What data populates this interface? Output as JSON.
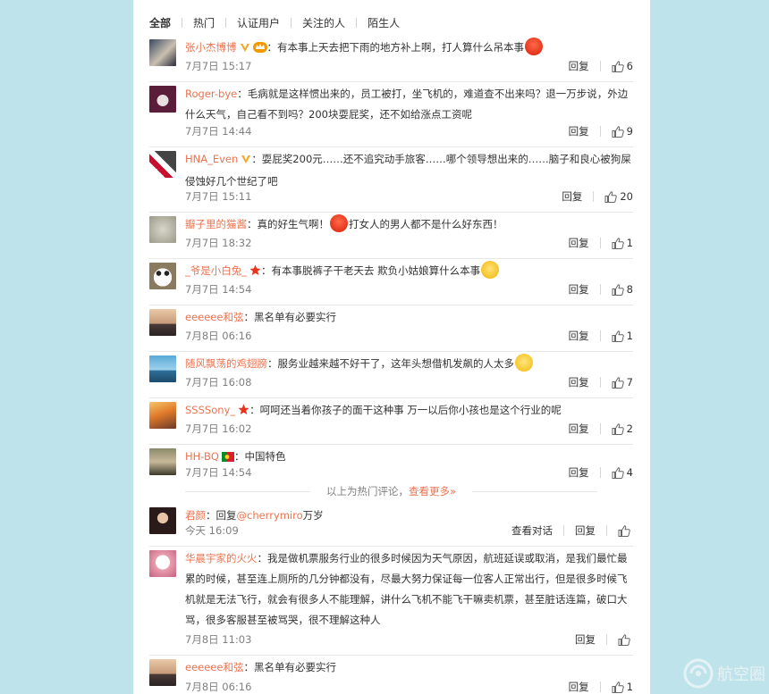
{
  "tabs": [
    "全部",
    "热门",
    "认证用户",
    "关注的人",
    "陌生人"
  ],
  "actions": {
    "reply": "回复",
    "view_conversation": "查看对话"
  },
  "hot_comments": [
    {
      "user": "张小杰博博",
      "verified": true,
      "text_parts": [
        "：有本事上天去把下雨的地方补上啊，打人算什么吊本事"
      ],
      "time": "7月7日 15:17",
      "likes": "6"
    },
    {
      "user": "Roger-bye",
      "text_parts": [
        "：毛病就是这样惯出来的，员工被打，坐飞机的，难道查不出来吗？退一万步说，外边什么天气，自己看不到吗？200块耍屁奖，还不如给涨点工资呢"
      ],
      "time": "7月7日 14:44",
      "likes": "9"
    },
    {
      "user": "HNA_Even",
      "verified": true,
      "text_parts": [
        "：耍屁奖200元……还不追究动手旅客……哪个领导想出来的……脑子和良心被狗屎侵蚀好几个世纪了吧"
      ],
      "time": "7月7日 15:11",
      "likes": "20"
    },
    {
      "user": "瓣子里的猫酱",
      "text_parts": [
        "：真的好生气啊！",
        "打女人的男人都不是什么好东西！"
      ],
      "time": "7月7日 18:32",
      "likes": "1"
    },
    {
      "user": "_爷是小白兔_",
      "star": true,
      "text_parts": [
        "：有本事脱裤子干老天去 欺负小姑娘算什么本事"
      ],
      "time": "7月7日 14:54",
      "likes": "8"
    },
    {
      "user": "eeeeee和弦",
      "text_parts": [
        "：黑名单有必要实行"
      ],
      "time": "7月8日 06:16",
      "likes": "1"
    },
    {
      "user": "随风飘荡的鸡翅膀",
      "text_parts": [
        "：服务业越来越不好干了，这年头想借机发飙的人太多"
      ],
      "time": "7月7日 16:08",
      "likes": "7"
    },
    {
      "user": "SSSSony_",
      "star": true,
      "text_parts": [
        "：呵呵还当着你孩子的面干这种事 万一以后你小孩也是这个行业的呢"
      ],
      "time": "7月7日 16:02",
      "likes": "2"
    },
    {
      "user": "HH-BQ",
      "flag": true,
      "text_parts": [
        "：中国特色"
      ],
      "time": "7月7日 14:54",
      "likes": "4"
    }
  ],
  "hot_divider": {
    "text": "以上为热门评论，",
    "more": "查看更多»"
  },
  "recent_comments": [
    {
      "user": "君颜",
      "text_parts": [
        "：回复",
        "@cherrymiro",
        "万岁"
      ],
      "time": "今天 16:09",
      "likes": ""
    },
    {
      "user": "华晨宇家的火火",
      "text_parts": [
        "：我是做机票服务行业的很多时候因为天气原因，航班延误或取消，是我们最忙最累的时候，甚至连上厕所的几分钟都没有，尽最大努力保证每一位客人正常出行，但是很多时候飞机就是无法飞行，就会有很多人不能理解，讲什么飞机不能飞干嘛卖机票，甚至脏话连篇，破口大骂，很多客服甚至被骂哭，很不理解这种人"
      ],
      "time": "7月8日 11:03",
      "likes": ""
    },
    {
      "user": "eeeeee和弦",
      "text_parts": [
        "：黑名单有必要实行"
      ],
      "time": "7月8日 06:16",
      "likes": "1"
    }
  ],
  "watermark": "航空圈",
  "colors": {
    "accent": "#eb7350",
    "time": "#808080",
    "background": "#bfe3eb"
  }
}
